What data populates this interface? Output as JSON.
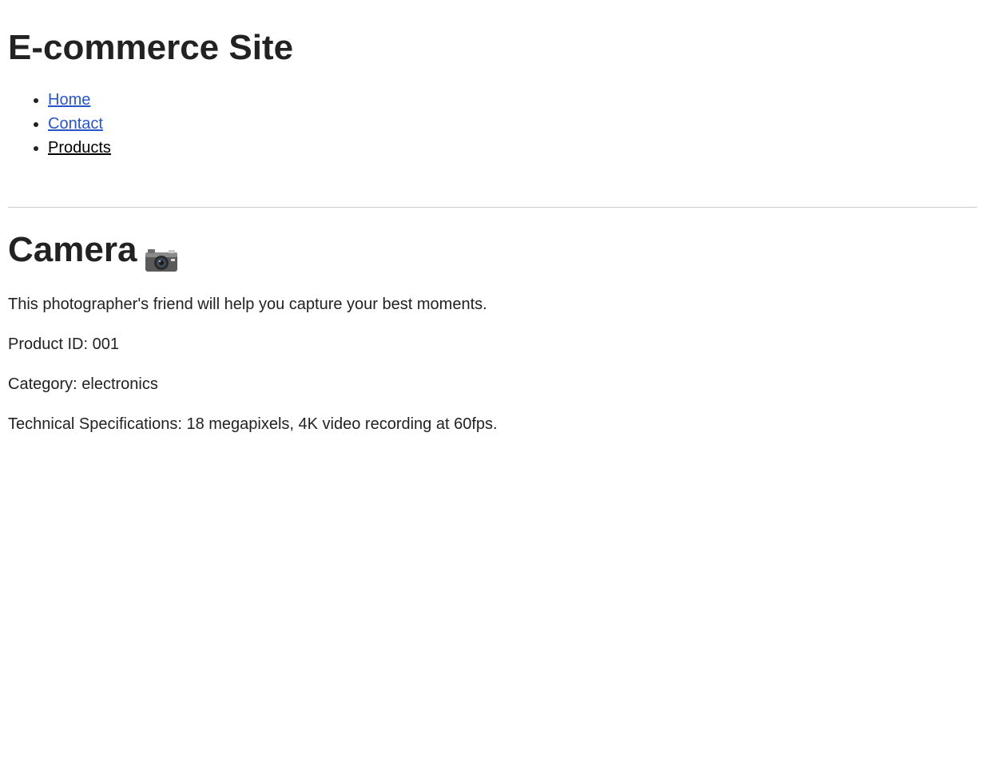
{
  "site": {
    "title": "E-commerce Site"
  },
  "nav": {
    "items": [
      {
        "label": "Home",
        "current": false
      },
      {
        "label": "Contact",
        "current": false
      },
      {
        "label": "Products",
        "current": true
      }
    ]
  },
  "product": {
    "name": "Camera",
    "icon": "camera-icon",
    "description": "This photographer's friend will help you capture your best moments.",
    "id_line": "Product ID: 001",
    "category_line": "Category: electronics",
    "specs_line": "Technical Specifications: 18 megapixels, 4K video recording at 60fps."
  },
  "colors": {
    "text": "#222222",
    "link": "#2a55c9",
    "current_link": "#000000",
    "divider": "#cccccc"
  }
}
